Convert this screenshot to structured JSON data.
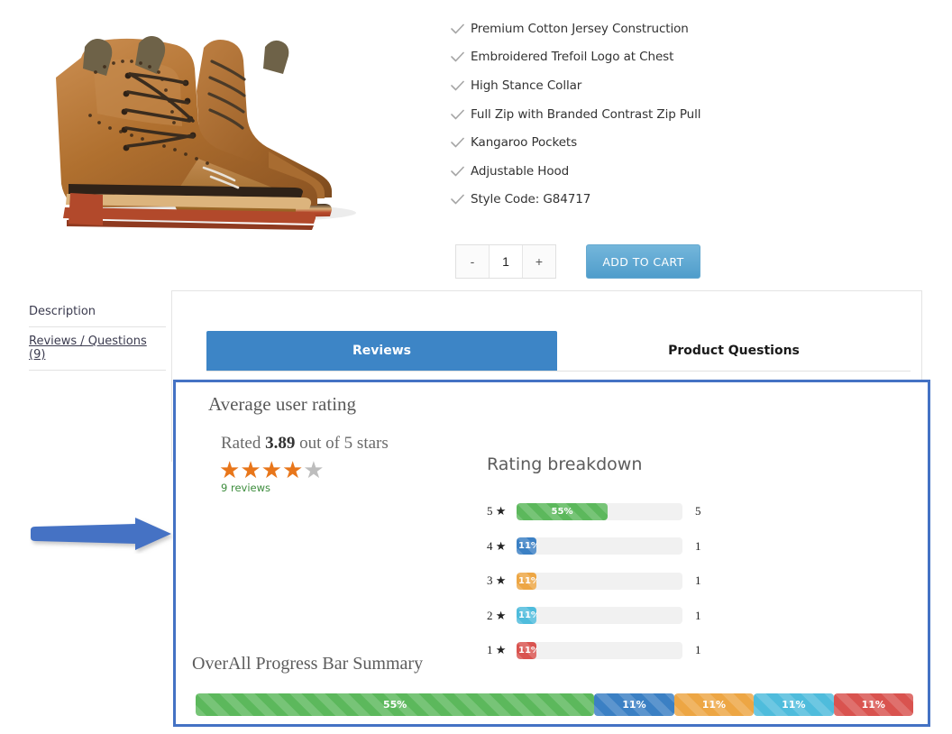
{
  "product": {
    "image_alt": "brown leather brogue boots",
    "features": [
      {
        "icon": "check-icon",
        "text": "Premium Cotton Jersey Construction"
      },
      {
        "icon": "check-icon",
        "text": "Embroidered Trefoil Logo at Chest"
      },
      {
        "icon": "check-icon",
        "text": "High Stance Collar"
      },
      {
        "icon": "check-icon",
        "text": "Full Zip with Branded Contrast Zip Pull"
      },
      {
        "icon": "check-icon",
        "text": "Kangaroo Pockets"
      },
      {
        "icon": "check-icon",
        "text": "Adjustable Hood"
      },
      {
        "icon": "check-icon",
        "text": "Style Code: G84717"
      }
    ],
    "quantity": {
      "decrement_label": "-",
      "value": "1",
      "increment_label": "+"
    },
    "add_to_cart_label": "ADD TO CART"
  },
  "side_nav": {
    "items": [
      {
        "label": "Description",
        "underlined": false
      },
      {
        "label": "Reviews / Questions (9)",
        "underlined": true
      }
    ]
  },
  "tabs": [
    {
      "label": "Reviews",
      "active": true
    },
    {
      "label": "Product Questions",
      "active": false
    }
  ],
  "reviews": {
    "average_title": "Average user rating",
    "rated_prefix": "Rated",
    "rated_score": "3.89",
    "rated_suffix": "out of 5 stars",
    "stars_filled": 4,
    "stars_total": 5,
    "review_count_label": "9 reviews",
    "breakdown_title": "Rating breakdown",
    "summary_title": "OverAll Progress Bar Summary"
  },
  "chart_data": {
    "type": "bar",
    "title": "Rating breakdown",
    "categories": [
      "5 ★",
      "4 ★",
      "3 ★",
      "2 ★",
      "1 ★"
    ],
    "values": [
      55,
      11,
      11,
      11,
      11
    ],
    "value_labels": [
      "55%",
      "11%",
      "11%",
      "11%",
      "11%"
    ],
    "counts": [
      "5",
      "1",
      "1",
      "1",
      "1"
    ],
    "colors": [
      "#5cb85c",
      "#3b80c4",
      "#eda644",
      "#4fbcdc",
      "#d9534f"
    ],
    "xlabel": "",
    "ylabel": "",
    "xlim": [
      0,
      100
    ],
    "grid": false,
    "legend": false,
    "orientation": "horizontal",
    "summary": {
      "type": "stacked-bar",
      "title": "OverAll Progress Bar Summary",
      "segments": [
        {
          "label": "55%",
          "value": 55,
          "color": "#5cb85c"
        },
        {
          "label": "11%",
          "value": 11,
          "color": "#3b80c4"
        },
        {
          "label": "11%",
          "value": 11,
          "color": "#eda644"
        },
        {
          "label": "11%",
          "value": 11,
          "color": "#4fbcdc"
        },
        {
          "label": "11%",
          "value": 11,
          "color": "#d9534f"
        }
      ]
    }
  },
  "annotation": {
    "arrow_color": "#4472c4",
    "highlight_color": "#4472c4"
  }
}
